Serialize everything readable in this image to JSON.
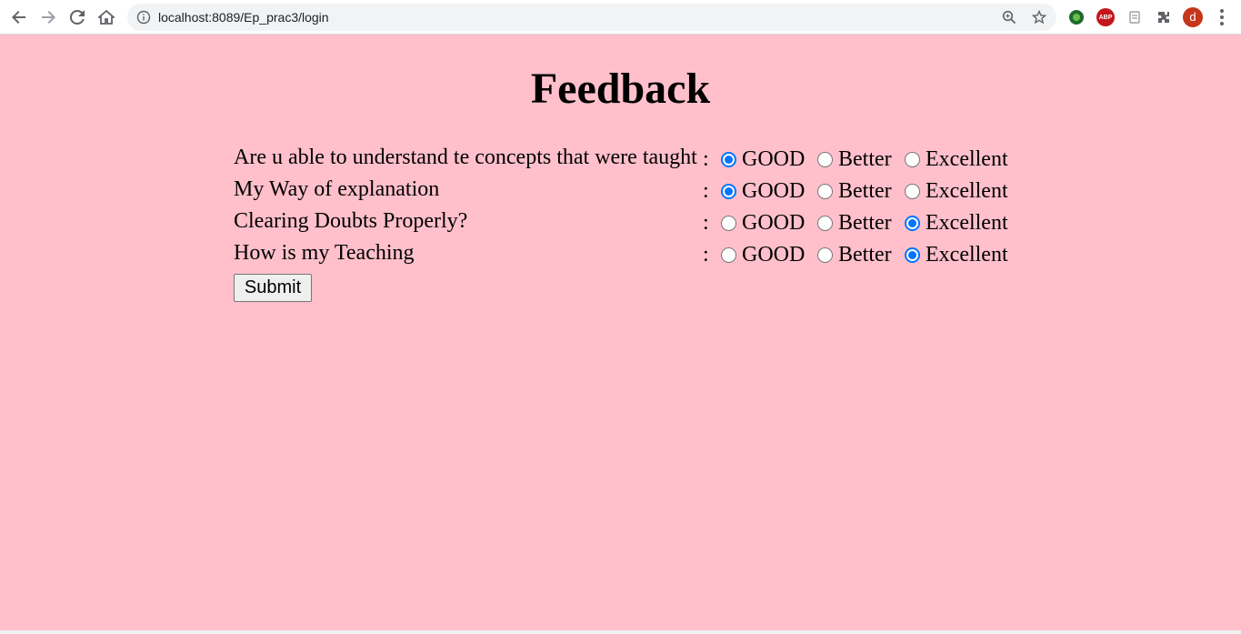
{
  "browser": {
    "url": "localhost:8089/Ep_prac3/login",
    "avatar_letter": "d",
    "abp_label": "ABP"
  },
  "page": {
    "title": "Feedback",
    "questions": [
      {
        "label": "Are u able to understand te concepts that were taught",
        "colon": ":",
        "selected": "GOOD"
      },
      {
        "label": "My Way of explanation",
        "colon": ":",
        "selected": "GOOD"
      },
      {
        "label": "Clearing Doubts Properly?",
        "colon": ":",
        "selected": "Excellent"
      },
      {
        "label": "How is my Teaching",
        "colon": ":",
        "selected": "Excellent"
      }
    ],
    "options": [
      "GOOD",
      "Better",
      "Excellent"
    ],
    "submit_label": "Submit"
  },
  "colors": {
    "page_background": "#ffc0cb",
    "radio_accent": "#0075ff"
  }
}
